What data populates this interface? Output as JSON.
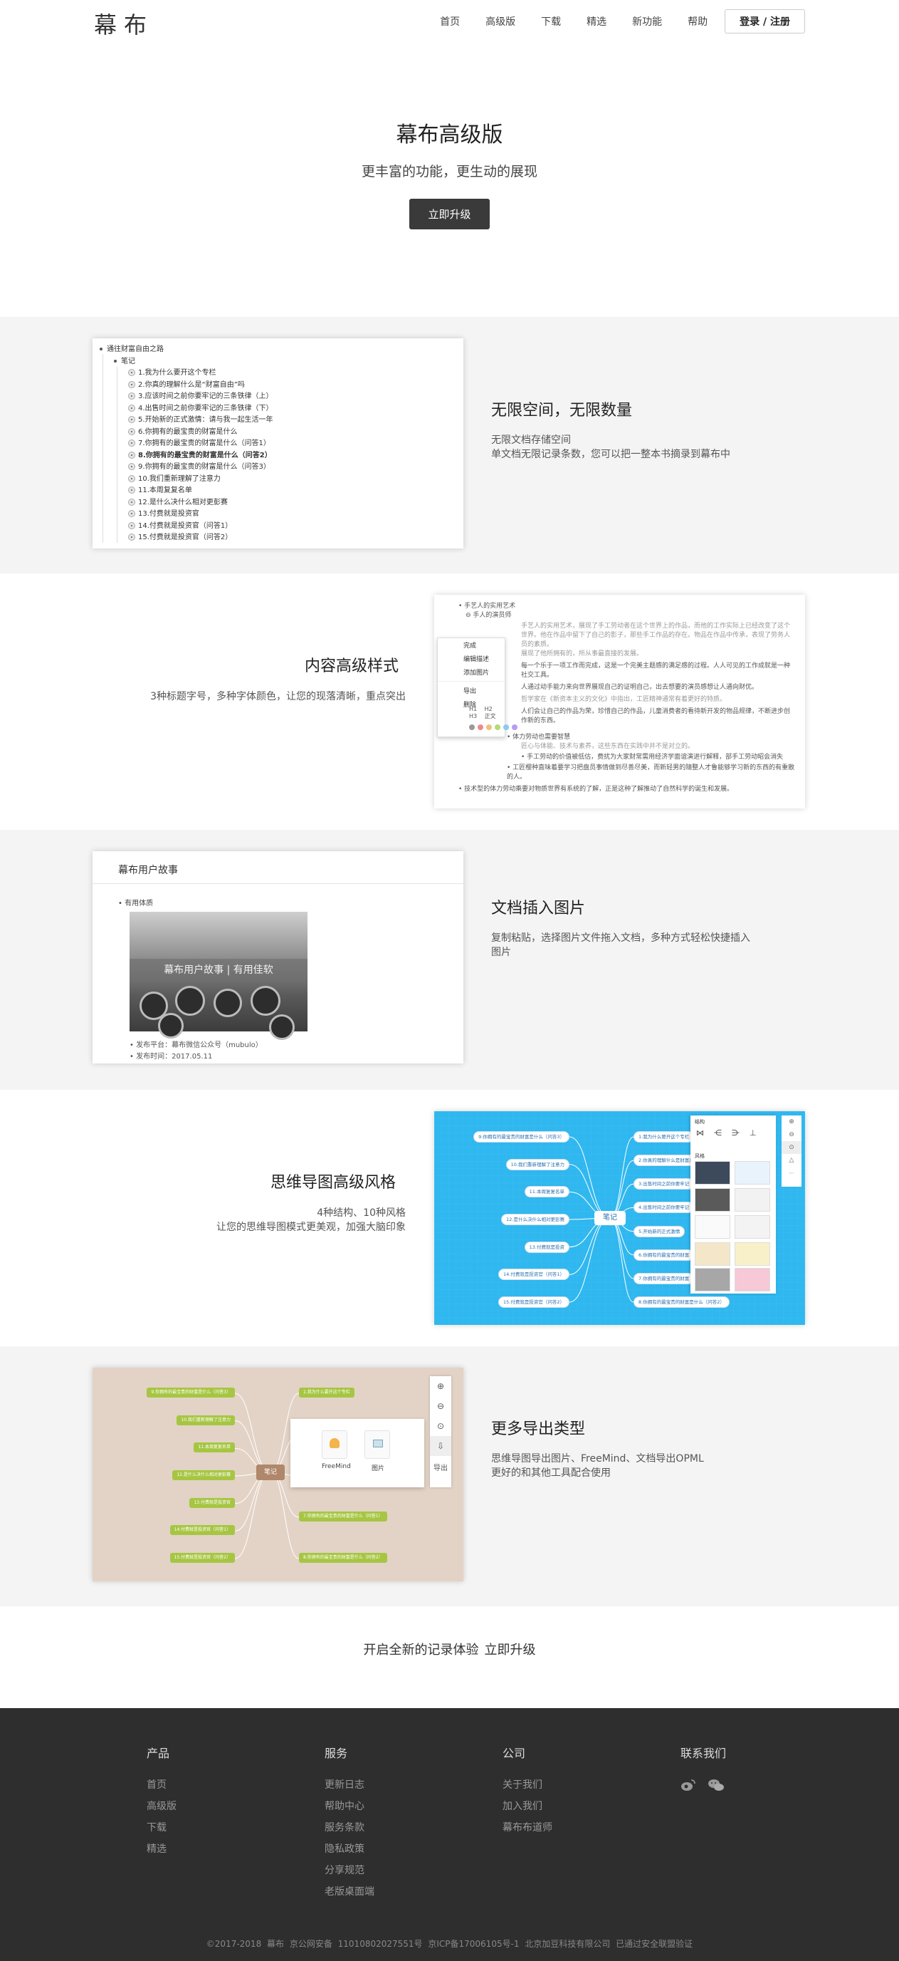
{
  "header": {
    "logo": "幕布",
    "nav": [
      "首页",
      "高级版",
      "下载",
      "精选",
      "新功能",
      "帮助"
    ],
    "login": "登录 / 注册"
  },
  "hero": {
    "title": "幕布高级版",
    "subtitle": "更丰富的功能，更生动的展现",
    "button": "立即升级"
  },
  "features": [
    {
      "title": "无限空间，无限数量",
      "desc1": "无限文档存储空间",
      "desc2": "单文档无限记录条数，您可以把一整本书摘录到幕布中"
    },
    {
      "title": "内容高级样式",
      "desc1": "3种标题字号，多种字体颜色，让您的现落清晰，重点突出"
    },
    {
      "title": "文档插入图片",
      "desc1": "复制粘贴，选择图片文件拖入文档，多种方式轻松快捷插入",
      "desc2": "图片"
    },
    {
      "title": "思维导图高级风格",
      "desc1": "4种结构、10种风格",
      "desc2": "让您的思维导图模式更美观，加强大脑印象"
    },
    {
      "title": "更多导出类型",
      "desc1": "思维导图导出图片、FreeMind、文档导出OPML",
      "desc2": "更好的和其他工具配合使用"
    }
  ],
  "outline": {
    "root": "通往财富自由之路",
    "child": "笔记",
    "items": [
      "1.我为什么要开这个专栏",
      "2.你真的理解什么是“财富自由”吗",
      "3.应该时间之前你要牢记的三条铁律（上）",
      "4.出售时间之前你要牢记的三条铁律（下）",
      "5.开始新的正式激情：请与我一起生活一年",
      "6.你拥有的最宝贵的财富是什么",
      "7.你拥有的最宝贵的财富是什么（问答1）",
      "8.你拥有的最宝贵的财富是什么（问答2）",
      "9.你拥有的最宝贵的财富是什么（问答3）",
      "10.我们重新理解了注意力",
      "11.本周复复名单",
      "12.是什么决什么相对更彭赛",
      "13.付费就是投资官",
      "14.付费就是投资官（问答1）",
      "15.付费就是投资官（问答2）"
    ]
  },
  "styles_doc": {
    "line1": "手艺人的实用艺术",
    "line2": "手人的演员师",
    "menu": [
      "完成",
      "编辑描述",
      "添加图片",
      "导出",
      "删除"
    ],
    "headings": [
      "H1",
      "H2",
      "H3",
      "正文"
    ],
    "swatch_colors": [
      "#999999",
      "#f08a8a",
      "#f0c27a",
      "#b5d87a",
      "#8ec9f0",
      "#b79cf0"
    ],
    "para": "人通过动手能力来向世界展现自己的证明自己，出去想要的演员感想让人通向财优。",
    "bullet1": "体力劳动也需要智慧",
    "bullet2": "手工劳动的价值被低估，费扰为大家財常需用经济学面谊演进行解释，部手工劳动昭会消失",
    "bullet3": "工匠樱种直味着要学习把盘员事情做到尽善尽美，而新轻男的隨整人才鲁能够学习新的东西的有重散的人。",
    "last": "技术型的体力劳动乘要对物质世界有系统的了解，正是这种了解推动了自然科学的诞生和发展。"
  },
  "story": {
    "title": "幕布用户故事",
    "child": "有用体质",
    "banner": "幕布用户故事 | 有用佳软",
    "meta1": "发布平台：幕布微信公众号（mubulo）",
    "meta2": "发布时间：2017.05.11"
  },
  "mindmap_blue": {
    "center": "笔记",
    "left": [
      "9.你拥有的最宝贵的财富是什么（问答3）",
      "10.我们重新理解了注意力",
      "11.本周复复名单",
      "12.是什么决什么相对更彭赛",
      "13.付费就是投资",
      "14.付费就是投资官（问答1）",
      "15.付费就是投资官（问答2）"
    ],
    "right": [
      "1.我为什么要开这个专栏",
      "2.你真的理解什么是财富自由",
      "3.出售时间之前你要牢记",
      "4.出售时间之前你要牢记",
      "5.开始新的正式激情",
      "6.你拥有的最宝贵的财富",
      "7.你拥有的最宝贵的财富",
      "8.你拥有的最宝贵的财富是什么（问答2）"
    ],
    "panel_title1": "结构",
    "panel_title2": "风格"
  },
  "mindmap_brown": {
    "center": "笔记",
    "left": [
      "9.你拥有的最宝贵的财富是什么（问答3）",
      "10.我们重新理解了注意力",
      "11.本周复复名单",
      "12.是什么决什么相对更彭赛",
      "13.付费就是投资官",
      "14.付费就是投资官（问答1）",
      "15.付费就是投资官（问答2）"
    ],
    "right": [
      "1.我为什么要开这个专栏",
      "2.你真的理解什么是财富自由吗",
      "6.你拥有的最宝贵的财富是什么",
      "7.你拥有的最宝贵的财富是什么（问答1）",
      "8.你拥有的最宝贵的财富是什么（问答2）"
    ],
    "export": [
      "FreeMind",
      "图片"
    ],
    "export_label": "导出"
  },
  "cta": {
    "text": "开启全新的记录体验",
    "link": "立即升级"
  },
  "footer": {
    "cols": [
      {
        "title": "产品",
        "links": [
          "首页",
          "高级版",
          "下载",
          "精选"
        ]
      },
      {
        "title": "服务",
        "links": [
          "更新日志",
          "帮助中心",
          "服务条款",
          "隐私政策",
          "分享规范",
          "老版桌面端"
        ]
      },
      {
        "title": "公司",
        "links": [
          "关于我们",
          "加入我们",
          "幕布布道师"
        ]
      },
      {
        "title": "联系我们",
        "links": []
      }
    ],
    "copyright": "©2017-2018 幕布  京公网安备 11010802027551号  京ICP备17006105号-1  北京加豆科技有限公司  已通过安全联盟验证"
  }
}
